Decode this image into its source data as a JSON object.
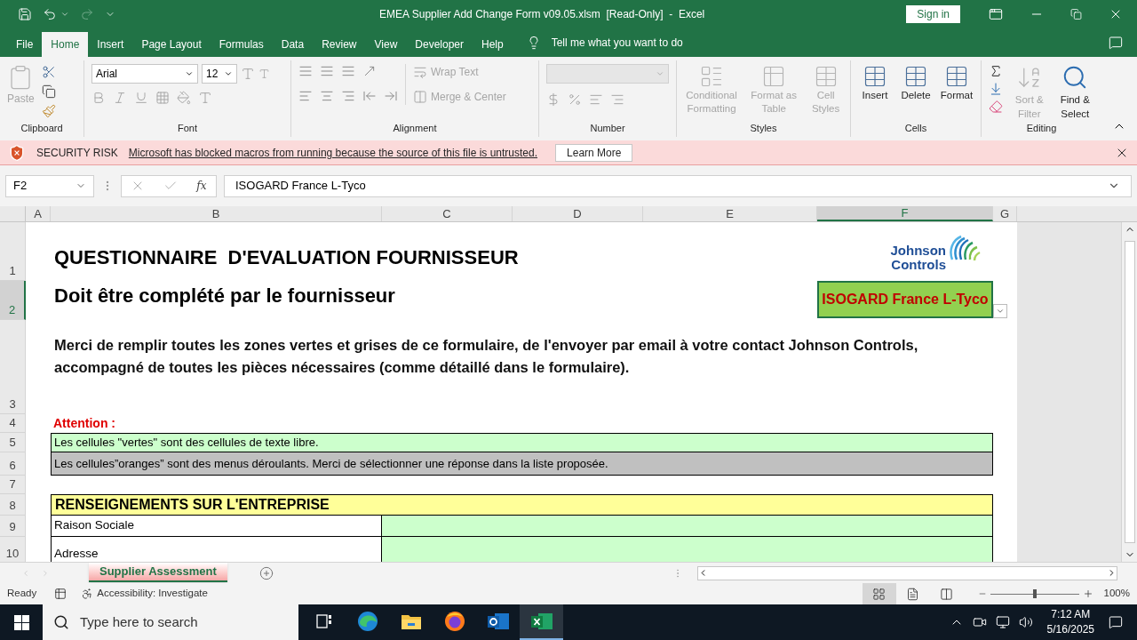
{
  "window": {
    "title": "EMEA Supplier Add Change Form v09.05.xlsm  [Read-Only]  -  Excel",
    "sign_in": "Sign in"
  },
  "ribbon_tabs": [
    {
      "label": "File",
      "selected": false
    },
    {
      "label": "Home",
      "selected": true
    },
    {
      "label": "Insert",
      "selected": false
    },
    {
      "label": "Page Layout",
      "selected": false
    },
    {
      "label": "Formulas",
      "selected": false
    },
    {
      "label": "Data",
      "selected": false
    },
    {
      "label": "Review",
      "selected": false
    },
    {
      "label": "View",
      "selected": false
    },
    {
      "label": "Developer",
      "selected": false
    },
    {
      "label": "Help",
      "selected": false
    }
  ],
  "tell_me": "Tell me what you want to do",
  "ribbon_groups": [
    {
      "kind": "clipboard",
      "label": "Clipboard",
      "buttons": [
        {
          "label": "Paste",
          "disabled": true
        }
      ]
    },
    {
      "kind": "font",
      "label": "Font",
      "font_name": "Arial",
      "font_size": "12"
    },
    {
      "kind": "alignment",
      "label": "Alignment",
      "buttons": [
        {
          "label": "Wrap Text",
          "disabled": true
        },
        {
          "label": "Merge & Center",
          "disabled": true
        }
      ]
    },
    {
      "kind": "number",
      "label": "Number"
    },
    {
      "kind": "styles",
      "label": "Styles",
      "buttons": [
        {
          "label": "Conditional Formatting",
          "disabled": true
        },
        {
          "label": "Format as Table",
          "disabled": true
        },
        {
          "label": "Cell Styles",
          "disabled": true
        }
      ]
    },
    {
      "kind": "cells",
      "label": "Cells",
      "buttons": [
        {
          "label": "Insert",
          "disabled": false
        },
        {
          "label": "Delete",
          "disabled": false
        },
        {
          "label": "Format",
          "disabled": false
        }
      ]
    },
    {
      "kind": "editing",
      "label": "Editing",
      "buttons": [
        {
          "label": "Sort & Filter",
          "disabled": true
        },
        {
          "label": "Find & Select",
          "disabled": false
        }
      ]
    }
  ],
  "security_bar": {
    "title": "SECURITY RISK",
    "message": "Microsoft has blocked macros from running because the source of this file is untrusted.",
    "button": "Learn More"
  },
  "formula_bar": {
    "name_box": "F2",
    "function_label": "fx",
    "value": "ISOGARD France L-Tyco"
  },
  "columns": [
    {
      "label": "A",
      "selected": false
    },
    {
      "label": "B",
      "selected": false
    },
    {
      "label": "C",
      "selected": false
    },
    {
      "label": "D",
      "selected": false
    },
    {
      "label": "E",
      "selected": false
    },
    {
      "label": "F",
      "selected": true
    },
    {
      "label": "G",
      "selected": false
    }
  ],
  "rows": [
    {
      "label": "1",
      "selected": false
    },
    {
      "label": "2",
      "selected": true
    },
    {
      "label": "3",
      "selected": false
    },
    {
      "label": "4",
      "selected": false
    },
    {
      "label": "5",
      "selected": false
    },
    {
      "label": "6",
      "selected": false
    },
    {
      "label": "7",
      "selected": false
    },
    {
      "label": "8",
      "selected": false
    },
    {
      "label": "9",
      "selected": false
    },
    {
      "label": "10",
      "selected": false
    }
  ],
  "sheet": {
    "title": "QUESTIONNAIRE  D'EVALUATION FOURNISSEUR",
    "subtitle": "Doit être complété par le fournisseur",
    "logo": {
      "line1": "Johnson",
      "line2": "Controls"
    },
    "active_cell": "ISOGARD France L-Tyco",
    "intro": "Merci de remplir toutes les zones vertes et grises de ce formulaire, de l'envoyer par email à votre contact Johnson Controls, accompagné de toutes les pièces nécessaires (comme détaillé dans le formulaire).",
    "attention": "Attention :",
    "notes": [
      {
        "text": "Les cellules \"vertes\" sont des cellules de texte libre.",
        "color": "#ccffcc"
      },
      {
        "text": "Les cellules”oranges” sont des menus déroulants. Merci de sélectionner une réponse dans la liste proposée.",
        "color": "#c0c0c0"
      }
    ],
    "section": "RENSEIGNEMENTS SUR L'ENTREPRISE",
    "fields": [
      {
        "label": "Raison Sociale"
      },
      {
        "label": "Adresse"
      }
    ]
  },
  "sheet_tabs": [
    {
      "label": "Supplier Assessment",
      "selected": true
    }
  ],
  "status_bar": {
    "mode": "Ready",
    "accessibility": "Accessibility: Investigate",
    "views": [
      {
        "kind": "normal",
        "selected": true
      },
      {
        "kind": "page-layout",
        "selected": false
      },
      {
        "kind": "page-break",
        "selected": false
      }
    ],
    "zoom": {
      "label": "100%",
      "level": 0.5
    }
  },
  "taskbar": {
    "search_placeholder": "Type here to search",
    "apps": [
      {
        "kind": "task-view",
        "selected": false
      },
      {
        "kind": "edge",
        "selected": false
      },
      {
        "kind": "explorer",
        "selected": false
      },
      {
        "kind": "firefox",
        "selected": false
      },
      {
        "kind": "outlook",
        "selected": false
      },
      {
        "kind": "excel",
        "selected": true
      }
    ],
    "time": "7:12 AM",
    "date": "5/16/2025"
  }
}
